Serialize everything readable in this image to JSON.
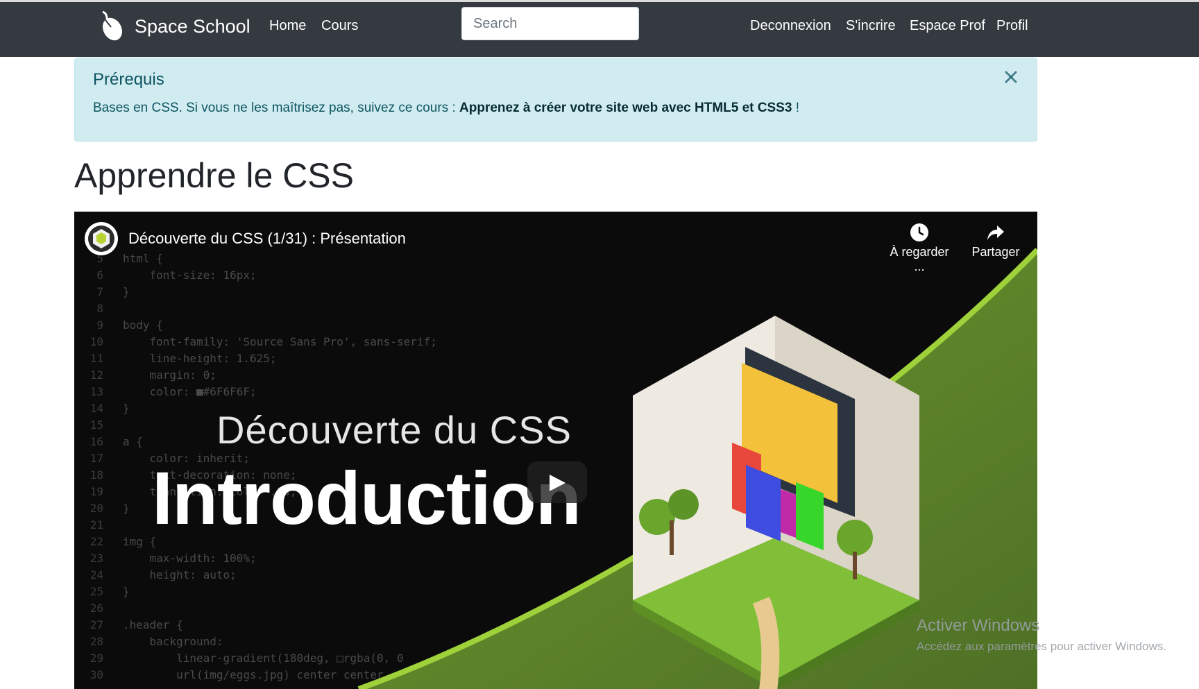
{
  "navbar": {
    "brand": "Space School",
    "links_left": [
      "Home",
      "Cours"
    ],
    "search_placeholder": "Search",
    "links_right": [
      "Deconnexion",
      "S'incrire",
      "Espace Prof",
      "Profil"
    ],
    "bg_color": "#343a40"
  },
  "alert": {
    "title": "Prérequis",
    "text_before": "Bases en CSS. Si vous ne les maîtrisez pas, suivez ce cours : ",
    "link_text": "Apprenez à créer votre site web avec HTML5 et CSS3",
    "text_after": " !",
    "close_icon": "close-icon",
    "bg_color": "#d1ecf1"
  },
  "page": {
    "heading": "Apprendre le CSS"
  },
  "video": {
    "title": "Découverte du CSS (1/31) : Présentation",
    "watch_later_label": "À regarder ...",
    "share_label": "Partager",
    "subtitle": "Découverte du CSS",
    "main_title": "Introduction",
    "code_lines": [
      {
        "n": "5",
        "t": "html {"
      },
      {
        "n": "6",
        "t": "    font-size: 16px;"
      },
      {
        "n": "7",
        "t": "}"
      },
      {
        "n": "8",
        "t": ""
      },
      {
        "n": "9",
        "t": "body {"
      },
      {
        "n": "10",
        "t": "    font-family: 'Source Sans Pro', sans-serif;"
      },
      {
        "n": "11",
        "t": "    line-height: 1.625;"
      },
      {
        "n": "12",
        "t": "    margin: 0;"
      },
      {
        "n": "13",
        "t": "    color: ■#6F6F6F;"
      },
      {
        "n": "14",
        "t": "}"
      },
      {
        "n": "15",
        "t": ""
      },
      {
        "n": "16",
        "t": "a {"
      },
      {
        "n": "17",
        "t": "    color: inherit;"
      },
      {
        "n": "18",
        "t": "    text-decoration: none;"
      },
      {
        "n": "19",
        "t": "    transition: color .2s;"
      },
      {
        "n": "20",
        "t": "}"
      },
      {
        "n": "21",
        "t": ""
      },
      {
        "n": "22",
        "t": "img {"
      },
      {
        "n": "23",
        "t": "    max-width: 100%;"
      },
      {
        "n": "24",
        "t": "    height: auto;"
      },
      {
        "n": "25",
        "t": "}"
      },
      {
        "n": "26",
        "t": ""
      },
      {
        "n": "27",
        "t": ".header {"
      },
      {
        "n": "28",
        "t": "    background:"
      },
      {
        "n": "29",
        "t": "        linear-gradient(180deg, □rgba(0, 0"
      },
      {
        "n": "30",
        "t": "        url(img/eggs.jpg) center center"
      }
    ]
  },
  "windows_watermark": {
    "line1": "Activer Windows",
    "line2": "Accédez aux paramètres pour activer Windows."
  }
}
